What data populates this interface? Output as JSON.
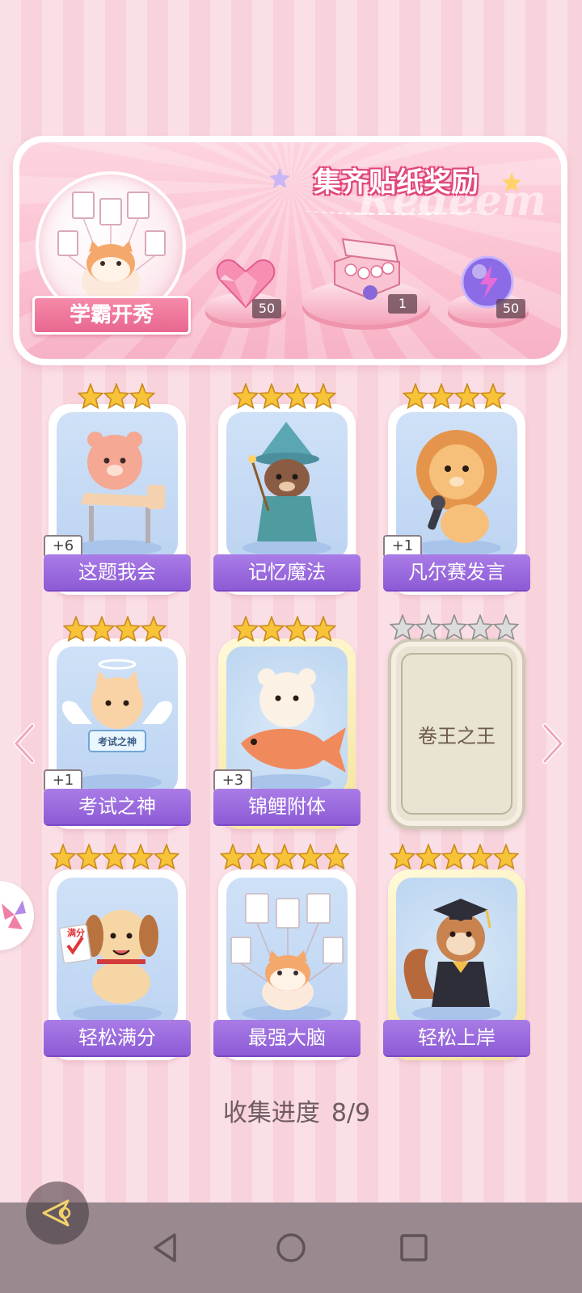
{
  "banner": {
    "title": "集齐贴纸奖励",
    "watermark": "Redeem",
    "badge_label": "学霸开秀",
    "rewards": [
      {
        "icon": "pink-heart-gem-icon",
        "qty": "50"
      },
      {
        "icon": "gift-box-icon",
        "qty": "1"
      },
      {
        "icon": "purple-energy-orb-icon",
        "qty": "50"
      }
    ]
  },
  "cards": [
    {
      "label": "这题我会",
      "count": "+6",
      "stars": 3,
      "icon": "bear-at-desk-icon"
    },
    {
      "label": "记忆魔法",
      "count": "",
      "stars": 4,
      "icon": "otter-wizard-icon"
    },
    {
      "label": "凡尔赛发言",
      "count": "+1",
      "stars": 4,
      "icon": "lion-microphone-icon"
    },
    {
      "label": "考试之神",
      "count": "+1",
      "stars": 4,
      "icon": "angel-cat-icon",
      "sign": "考试之神"
    },
    {
      "label": "锦鲤附体",
      "count": "+3",
      "stars": 4,
      "icon": "bear-koi-fish-icon"
    },
    {
      "label": "卷王之王",
      "count": "",
      "stars": 5,
      "locked": true
    },
    {
      "label": "轻松满分",
      "count": "",
      "stars": 5,
      "icon": "puppy-full-score-icon",
      "sign": "满分"
    },
    {
      "label": "最强大脑",
      "count": "",
      "stars": 5,
      "icon": "cat-with-papers-icon"
    },
    {
      "label": "轻松上岸",
      "count": "",
      "stars": 5,
      "icon": "squirrel-graduate-icon"
    }
  ],
  "progress": {
    "label": "收集进度",
    "value": "8/9"
  },
  "colors": {
    "accent_purple": "#8d5bd6",
    "pink": "#f58aa9",
    "star": "#f7c338"
  }
}
